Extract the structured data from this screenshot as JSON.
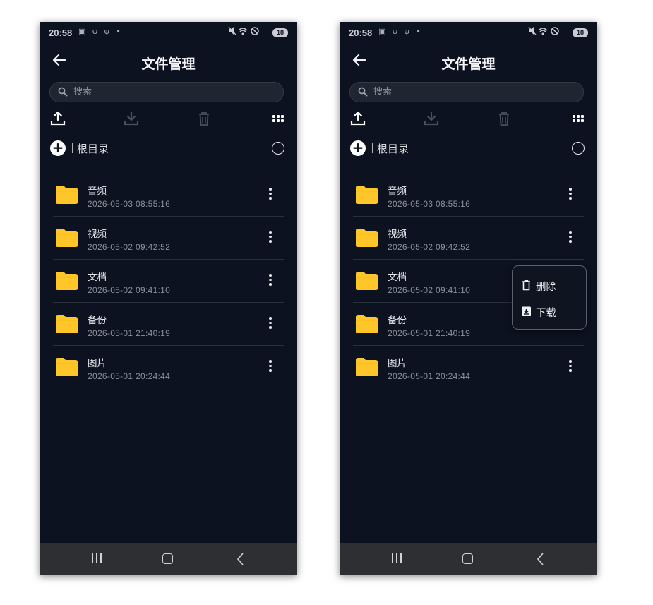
{
  "status_bar": {
    "time": "20:58",
    "left_icons": "▣ ψ ψ •",
    "right_icons": "⊘",
    "battery": "18"
  },
  "app": {
    "title": "文件管理",
    "search_placeholder": "搜索",
    "root_label": "根目录"
  },
  "toolbar": {
    "icons": [
      "upload-icon",
      "download-icon",
      "delete-icon",
      "grid-view-icon"
    ],
    "enabled": [
      true,
      false,
      false,
      true
    ]
  },
  "files": [
    {
      "name": "音频",
      "date": "2026-05-03 08:55:16"
    },
    {
      "name": "视频",
      "date": "2026-05-02 09:42:52"
    },
    {
      "name": "文档",
      "date": "2026-05-02 09:41:10"
    },
    {
      "name": "备份",
      "date": "2026-05-01 21:40:19"
    },
    {
      "name": "图片",
      "date": "2026-05-01 20:24:44"
    }
  ],
  "context_menu": {
    "delete_label": "删除",
    "download_label": "下载"
  },
  "colors": {
    "background": "#0c1220",
    "folder": "#FFC629",
    "nav_bar": "#2e2f33",
    "text_primary": "#e8eaed",
    "text_secondary": "#8b919a"
  }
}
